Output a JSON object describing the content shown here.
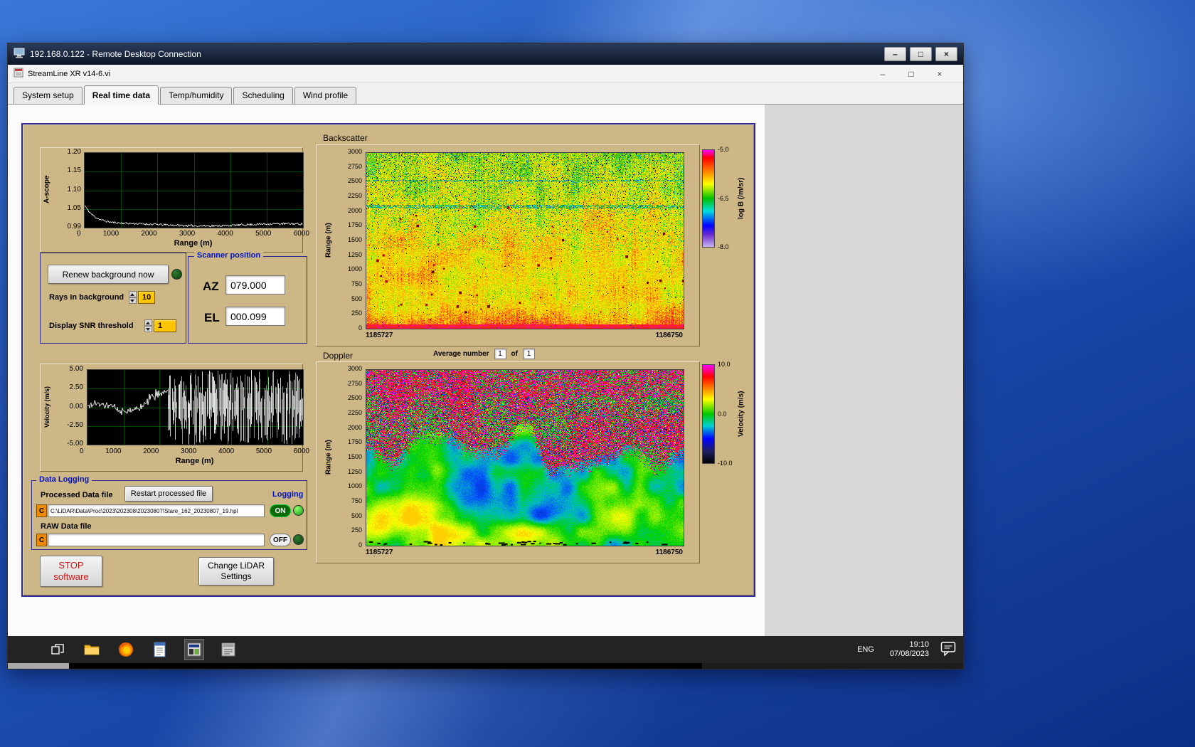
{
  "colors": {
    "panel_tan": "#cdb787",
    "panel_border_navy": "#2b2b8f",
    "label_blue": "#0013c3",
    "value_yellow": "#fdc500",
    "stop_red": "#d01616",
    "taskbar_bg": "#232323"
  },
  "window_controls": {
    "minimize": "–",
    "maximize": "□",
    "close": "×"
  },
  "rdp": {
    "title": "192.168.0.122 - Remote Desktop Connection"
  },
  "app": {
    "title": "StreamLine XR v14-6.vi",
    "tabs": [
      "System setup",
      "Real time data",
      "Temp/humidity",
      "Scheduling",
      "Wind profile"
    ],
    "active_index": 1
  },
  "ascope": {
    "y_label": "A-scope",
    "x_label": "Range (m)",
    "y_ticks": [
      "1.20",
      "1.15",
      "1.10",
      "1.05",
      "0.99"
    ],
    "x_ticks": [
      "0",
      "1000",
      "2000",
      "3000",
      "4000",
      "5000",
      "6000"
    ]
  },
  "background_controls": {
    "renew_button": "Renew background now",
    "rays_label": "Rays in background",
    "rays_value": "10",
    "snr_label": "Display SNR threshold",
    "snr_value": "1"
  },
  "scanner": {
    "title": "Scanner position",
    "az_label": "AZ",
    "az_value": "079.000",
    "el_label": "EL",
    "el_value": "000.099"
  },
  "backscatter": {
    "title": "Backscatter",
    "y_label": "Range (m)",
    "y_ticks": [
      "3000",
      "2750",
      "2500",
      "2250",
      "2000",
      "1750",
      "1500",
      "1250",
      "1000",
      "750",
      "500",
      "250",
      "0"
    ],
    "x_start": "1185727",
    "x_end": "1186750",
    "colorbar_ticks": [
      "-5.0",
      "-6.5",
      "-8.0"
    ],
    "colorbar_label": "log B (/m/sr)"
  },
  "doppler": {
    "title": "Doppler",
    "average_label": "Average number",
    "average_value": "1",
    "of_label": "of",
    "of_total": "1",
    "y_label": "Range (m)",
    "y_ticks": [
      "3000",
      "2750",
      "2500",
      "2250",
      "2000",
      "1750",
      "1500",
      "1250",
      "1000",
      "750",
      "500",
      "250",
      "0"
    ],
    "x_start": "1185727",
    "x_end": "1186750",
    "colorbar_ticks": [
      "10.0",
      "0.0",
      "-10.0"
    ],
    "colorbar_label": "Velocity (m/s)"
  },
  "velocity_plot": {
    "y_label": "Velocity (m/s)",
    "x_label": "Range (m)",
    "y_ticks": [
      "5.00",
      "2.50",
      "0.00",
      "-2.50",
      "-5.00"
    ],
    "x_ticks": [
      "0",
      "1000",
      "2000",
      "3000",
      "4000",
      "5000",
      "6000"
    ]
  },
  "data_logging": {
    "title": "Data Logging",
    "processed_label": "Processed Data file",
    "restart_button": "Restart processed file",
    "logging_label": "Logging",
    "drive": "C",
    "processed_path": "C:\\LiDAR\\Data\\Proc\\2023\\202308\\20230807\\Stare_162_20230807_19.hpl",
    "on_label": "ON",
    "raw_label": "RAW Data file",
    "raw_path": "",
    "off_label": "OFF"
  },
  "actions": {
    "stop_line1": "STOP",
    "stop_line2": "software",
    "change_line1": "Change LiDAR",
    "change_line2": "Settings"
  },
  "taskbar": {
    "language": "ENG",
    "time": "19:10",
    "date": "07/08/2023"
  }
}
